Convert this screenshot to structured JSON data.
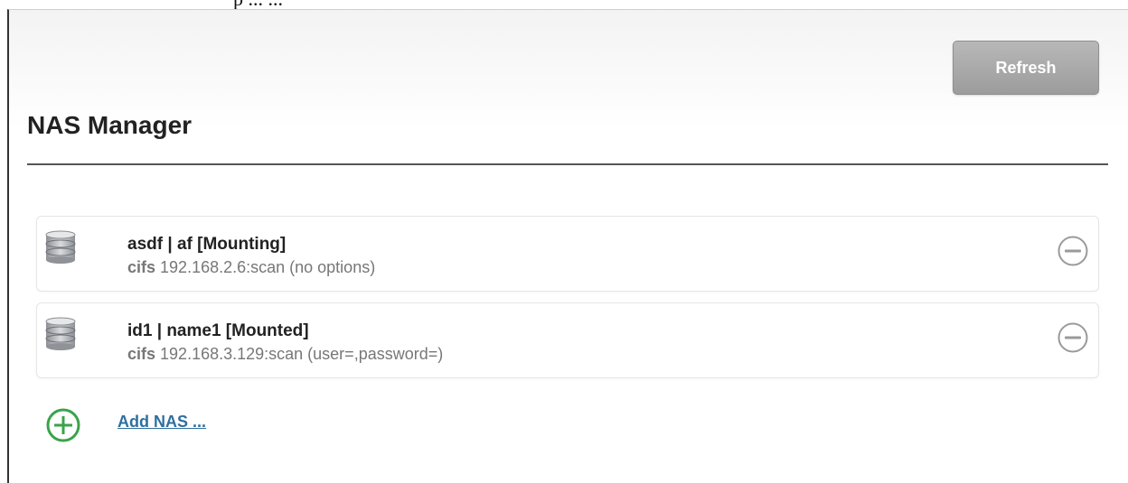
{
  "top_strip": {
    "text": "p ... ..."
  },
  "header": {
    "refresh_label": "Refresh",
    "title": "NAS Manager"
  },
  "nas_items": [
    {
      "name": "asdf | af [Mounting]",
      "protocol": "cifs",
      "detail": " 192.168.2.6:scan (no options)"
    },
    {
      "name": "id1 | name1 [Mounted]",
      "protocol": "cifs",
      "detail": " 192.168.3.129:scan (user=,password=)"
    }
  ],
  "add": {
    "label": "Add NAS ..."
  },
  "colors": {
    "accent_green": "#3aa34a",
    "link_blue": "#2f6f9f",
    "button_gray": "#a8a8a8",
    "remove_gray": "#9a9a9a"
  },
  "icons": {
    "item_icon": "database-icon",
    "remove_icon": "minus-circle-icon",
    "add_icon": "plus-circle-icon"
  }
}
